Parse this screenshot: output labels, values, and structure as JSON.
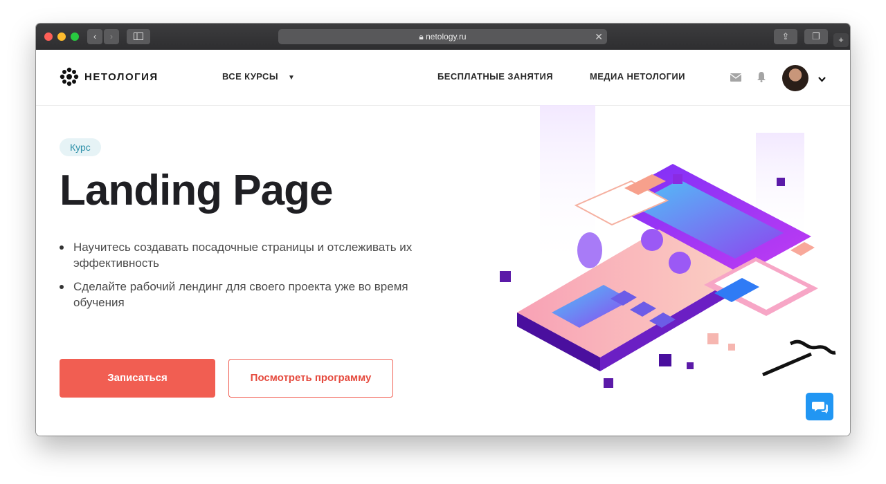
{
  "browser": {
    "url": "netology.ru"
  },
  "nav": {
    "logo_text": "НЕТОЛОГИЯ",
    "all_courses": "ВСЕ КУРСЫ",
    "free_lessons": "БЕСПЛАТНЫЕ ЗАНЯТИЯ",
    "media": "МЕДИА НЕТОЛОГИИ"
  },
  "hero": {
    "badge": "Курс",
    "title": "Landing Page",
    "bullets": [
      "Научитесь создавать посадочные страницы и отслеживать их эффективность",
      "Сделайте рабочий лендинг для своего проекта уже во время обучения"
    ],
    "primary_button": "Записаться",
    "secondary_button": "Посмотреть программу"
  },
  "colors": {
    "accent": "#f15e52",
    "badge_bg": "#e6f3f6",
    "chat_button": "#2196f3"
  },
  "icons": [
    "back-arrow-icon",
    "forward-arrow-icon",
    "sidebar-icon",
    "lock-icon",
    "share-icon",
    "tabs-icon",
    "plus-icon",
    "logo-icon",
    "mail-icon",
    "bell-icon",
    "chevron-down-icon",
    "chat-icon"
  ]
}
